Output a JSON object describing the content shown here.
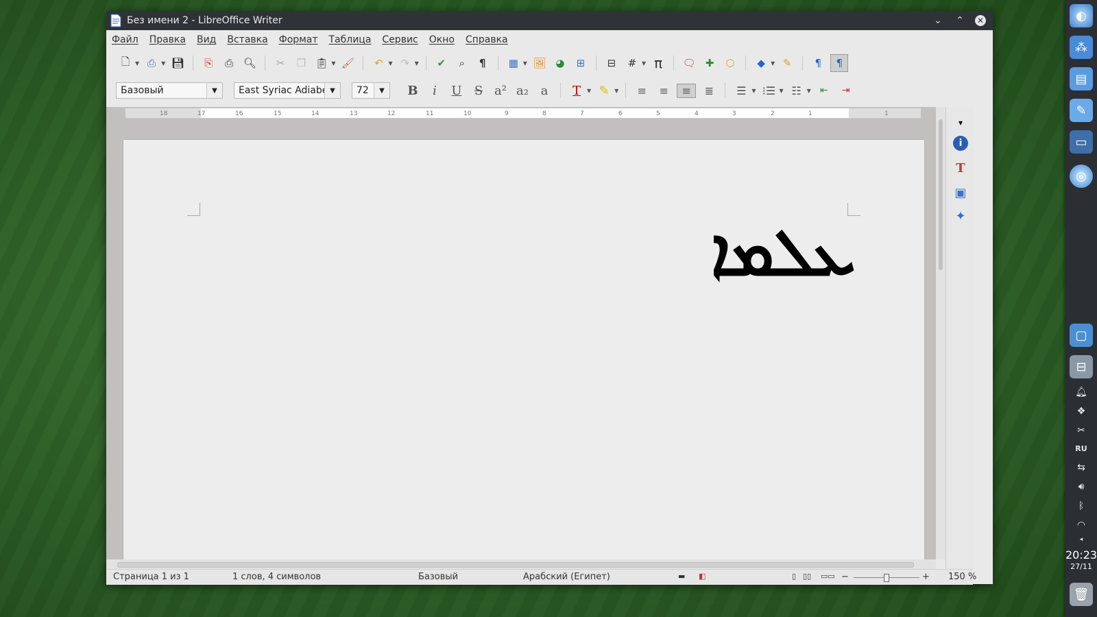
{
  "window": {
    "title": "Без имени 2 - LibreOffice Writer"
  },
  "menu": [
    "Файл",
    "Правка",
    "Вид",
    "Вставка",
    "Формат",
    "Таблица",
    "Сервис",
    "Окно",
    "Справка"
  ],
  "formatting": {
    "paragraph_style": "Базовый",
    "font_name": "East Syriac Adiabene",
    "font_size": "72"
  },
  "ruler": {
    "ticks": [
      "18",
      "17",
      "16",
      "15",
      "14",
      "13",
      "12",
      "11",
      "10",
      "9",
      "8",
      "7",
      "6",
      "5",
      "4",
      "3",
      "2",
      "1",
      "1"
    ]
  },
  "document": {
    "text": "ܥܠܡܐ"
  },
  "status": {
    "page": "Страница 1 из 1",
    "words": "1 слов, 4 символов",
    "style": "Базовый",
    "language": "Арабский (Египет)",
    "zoom": "150 %"
  },
  "dock": {
    "time": "20:23",
    "date": "27/11",
    "layout": "RU"
  }
}
